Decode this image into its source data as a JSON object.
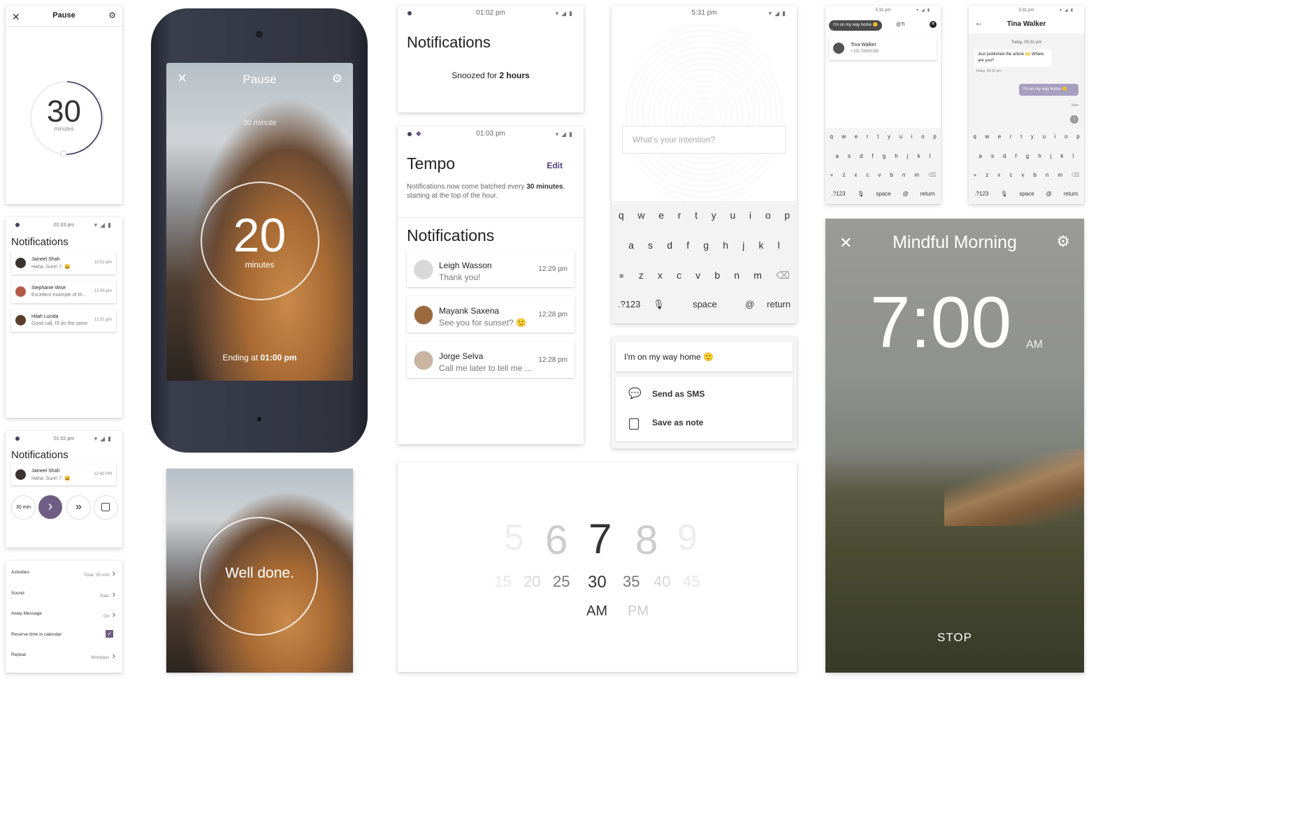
{
  "colors": {
    "accent": "#6f5d84",
    "dark": "#2c2740",
    "ring": "#3c3357"
  },
  "pause_small": {
    "title": "Pause",
    "value": "30",
    "unit": "minutes"
  },
  "phone": {
    "title": "Pause",
    "subtitle": "30 minute",
    "value": "20",
    "unit": "minutes",
    "ending_prefix": "Ending at ",
    "ending_time": "01:00 pm"
  },
  "notif_list": {
    "time": "01:03 pm",
    "title": "Notifications",
    "items": [
      {
        "name": "Jaineel Shah",
        "msg": "Haha. Sure! 7. 😀",
        "time": "12:52 pm"
      },
      {
        "name": "Stephanie Wise",
        "msg": "Excellent example of th...",
        "time": "12:45 pm"
      },
      {
        "name": "Hilah Lucida",
        "msg": "Good call, I'll do the same",
        "time": "12:31 pm"
      }
    ]
  },
  "notif_small": {
    "time": "01:02 pm",
    "title": "Notifications",
    "item": {
      "name": "Jaineel Shah",
      "msg": "Haha. Sure! 7. 😀",
      "time": "12:40 PM"
    },
    "btn30": "30 min"
  },
  "settings": [
    {
      "label": "Activities",
      "value": "Total: 55 min"
    },
    {
      "label": "Sound",
      "value": "Rain"
    },
    {
      "label": "Away Message",
      "value": "On"
    },
    {
      "label": "Reserve time in calendar",
      "value": ""
    },
    {
      "label": "Repeat",
      "value": "Mondays"
    }
  ],
  "well_done": {
    "text": "Well done."
  },
  "snoozed": {
    "time": "01:02 pm",
    "title": "Notifications",
    "prefix": "Snoozed for ",
    "bold": "2 hours"
  },
  "tempo": {
    "time": "01:03 pm",
    "title": "Tempo",
    "edit": "Edit",
    "desc_a": "Notifications now come batched every ",
    "desc_b": "30 minutes",
    "desc_c": ", starting at the top of the hour.",
    "notif_title": "Notifications",
    "items": [
      {
        "name": "Leigh Wasson",
        "msg": "Thank you!",
        "time": "12:29 pm"
      },
      {
        "name": "Mayank Saxena",
        "msg": "See you for sunset? 🙂",
        "time": "12:28 pm"
      },
      {
        "name": "Jorge Selva",
        "msg": "Call me later to tell me ...",
        "time": "12:28 pm"
      }
    ]
  },
  "intention": {
    "time": "5:31 pm",
    "placeholder": "What's your intention?"
  },
  "keyboard": {
    "row1": [
      "q",
      "w",
      "e",
      "r",
      "t",
      "y",
      "u",
      "i",
      "o",
      "p"
    ],
    "row2": [
      "a",
      "s",
      "d",
      "f",
      "g",
      "h",
      "j",
      "k",
      "l"
    ],
    "row3": [
      "z",
      "x",
      "c",
      "v",
      "b",
      "n",
      "m"
    ],
    "sym": ".?123",
    "space": "space",
    "at": "@",
    "ret": "return"
  },
  "share": {
    "message": "I'm on my way home 🙂",
    "sms": "Send as SMS",
    "note": "Save as note"
  },
  "picker": {
    "hours": [
      "5",
      "6",
      "7",
      "8",
      "9"
    ],
    "minutes": [
      "15",
      "20",
      "25",
      "30",
      "35",
      "40",
      "45"
    ],
    "am": "AM",
    "pm": "PM"
  },
  "search": {
    "time": "5:31 pm",
    "chip": "I'm on my way home 🙂",
    "query": "@Ti",
    "contact": "Tina Walker",
    "phone": "+19178690088"
  },
  "chat": {
    "time": "5:31 pm",
    "name": "Tina Walker",
    "date1": "Today, 05:31 pm",
    "msg_in": "Just published the article 🙌 Where are you?",
    "date2": "Today, 05:31 pm",
    "msg_out": "I'm on my way home 🙂",
    "now": "Now"
  },
  "alarm": {
    "title": "Mindful Morning",
    "time": "7:00",
    "ampm": "AM",
    "stop": "STOP"
  }
}
